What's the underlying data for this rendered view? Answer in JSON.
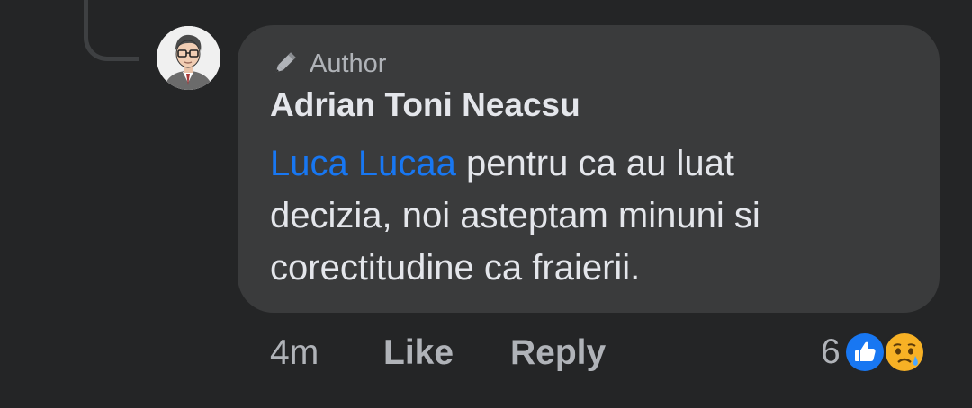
{
  "comment": {
    "badge_label": "Author",
    "author_name": "Adrian Toni Neacsu",
    "mention": "Luca Lucaa",
    "body_line1_rest": " pentru ca au luat",
    "body_line2": "decizia, noi asteptam minuni si",
    "body_line3": "corectitudine ca fraierii."
  },
  "actions": {
    "time": "4m",
    "like_label": "Like",
    "reply_label": "Reply"
  },
  "reactions": {
    "count": "6",
    "icons": [
      "like-reaction-icon",
      "sad-reaction-icon"
    ]
  },
  "colors": {
    "background": "#242526",
    "bubble": "#3a3b3c",
    "primary_text": "#e4e6eb",
    "secondary_text": "#b0b3b8",
    "mention": "#1877f2",
    "like_reaction": "#1877f2",
    "sad_reaction": "#f7b125"
  }
}
